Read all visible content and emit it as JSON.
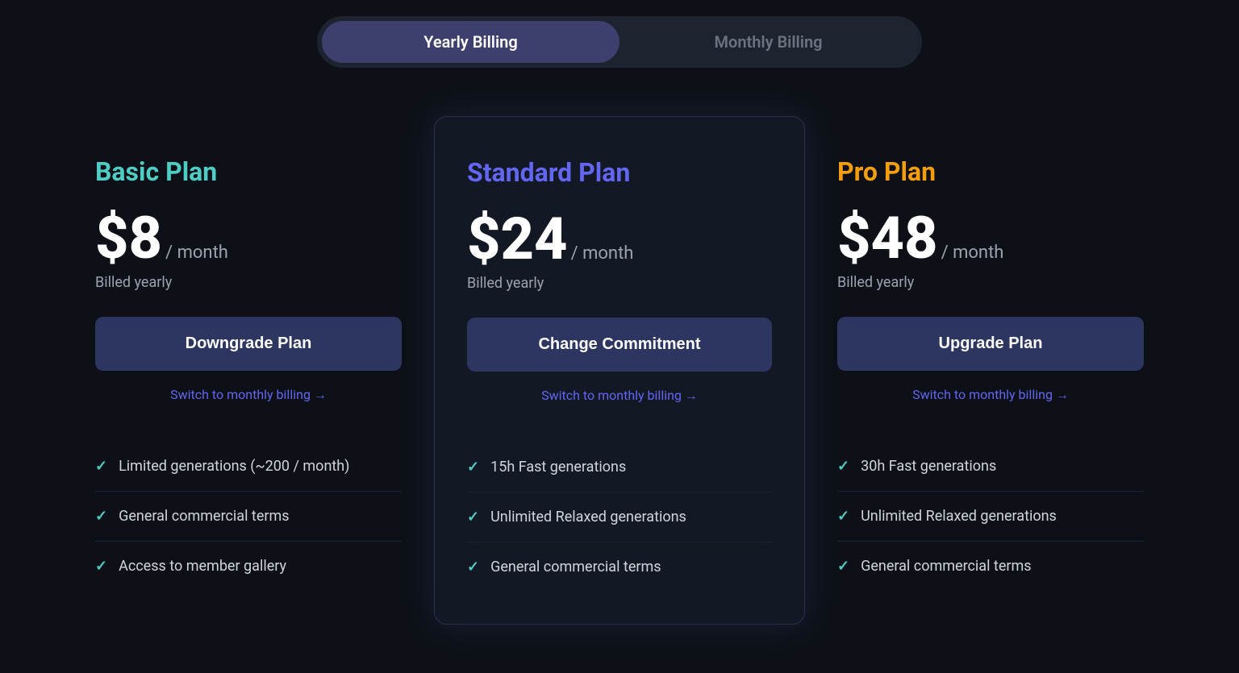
{
  "billing_toggle": {
    "yearly_label": "Yearly Billing",
    "monthly_label": "Monthly Billing",
    "active": "yearly"
  },
  "plans": [
    {
      "id": "basic",
      "name": "Basic Plan",
      "color_class": "basic",
      "price": "$8",
      "period": "/ month",
      "billed": "Billed yearly",
      "button_label": "Downgrade Plan",
      "switch_label": "Switch to monthly billing →",
      "features": [
        "Limited generations (~200 / month)",
        "General commercial terms",
        "Access to member gallery"
      ]
    },
    {
      "id": "standard",
      "name": "Standard Plan",
      "color_class": "standard",
      "price": "$24",
      "period": "/ month",
      "billed": "Billed yearly",
      "button_label": "Change Commitment",
      "switch_label": "Switch to monthly billing →",
      "features": [
        "15h Fast generations",
        "Unlimited Relaxed generations",
        "General commercial terms"
      ]
    },
    {
      "id": "pro",
      "name": "Pro Plan",
      "color_class": "pro",
      "price": "$48",
      "period": "/ month",
      "billed": "Billed yearly",
      "button_label": "Upgrade Plan",
      "switch_label": "Switch to monthly billing →",
      "features": [
        "30h Fast generations",
        "Unlimited Relaxed generations",
        "General commercial terms"
      ]
    }
  ]
}
